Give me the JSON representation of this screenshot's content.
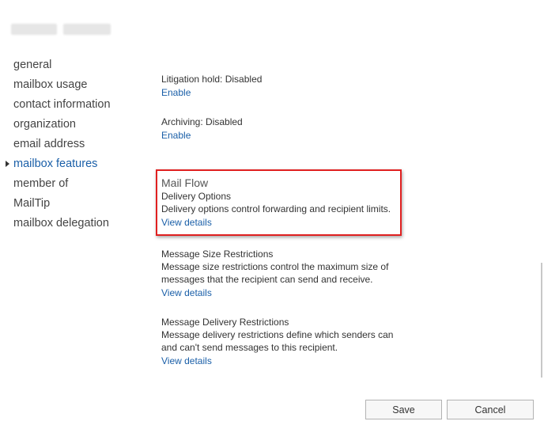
{
  "nav": {
    "items": [
      {
        "label": "general"
      },
      {
        "label": "mailbox usage"
      },
      {
        "label": "contact information"
      },
      {
        "label": "organization"
      },
      {
        "label": "email address"
      },
      {
        "label": "mailbox features"
      },
      {
        "label": "member of"
      },
      {
        "label": "MailTip"
      },
      {
        "label": "mailbox delegation"
      }
    ],
    "selected": "mailbox features"
  },
  "content": {
    "litigation_hold": {
      "status": "Litigation hold: Disabled",
      "link": "Enable"
    },
    "archiving": {
      "status": "Archiving: Disabled",
      "link": "Enable"
    },
    "mail_flow": {
      "header": "Mail Flow",
      "delivery_options": {
        "title": "Delivery Options",
        "description": "Delivery options control forwarding and recipient limits.",
        "link": "View details"
      },
      "message_size": {
        "title": "Message Size Restrictions",
        "description_line1": "Message size restrictions control the maximum size of",
        "description_line2": "messages that the recipient can send and receive.",
        "link": "View details"
      },
      "message_delivery": {
        "title": "Message Delivery Restrictions",
        "description_line1": "Message delivery restrictions define which senders can",
        "description_line2": "and can't send messages to this recipient.",
        "link": "View details"
      }
    }
  },
  "buttons": {
    "save": "Save",
    "cancel": "Cancel"
  },
  "colors": {
    "link": "#1a5fa8",
    "highlight": "#e02020"
  }
}
